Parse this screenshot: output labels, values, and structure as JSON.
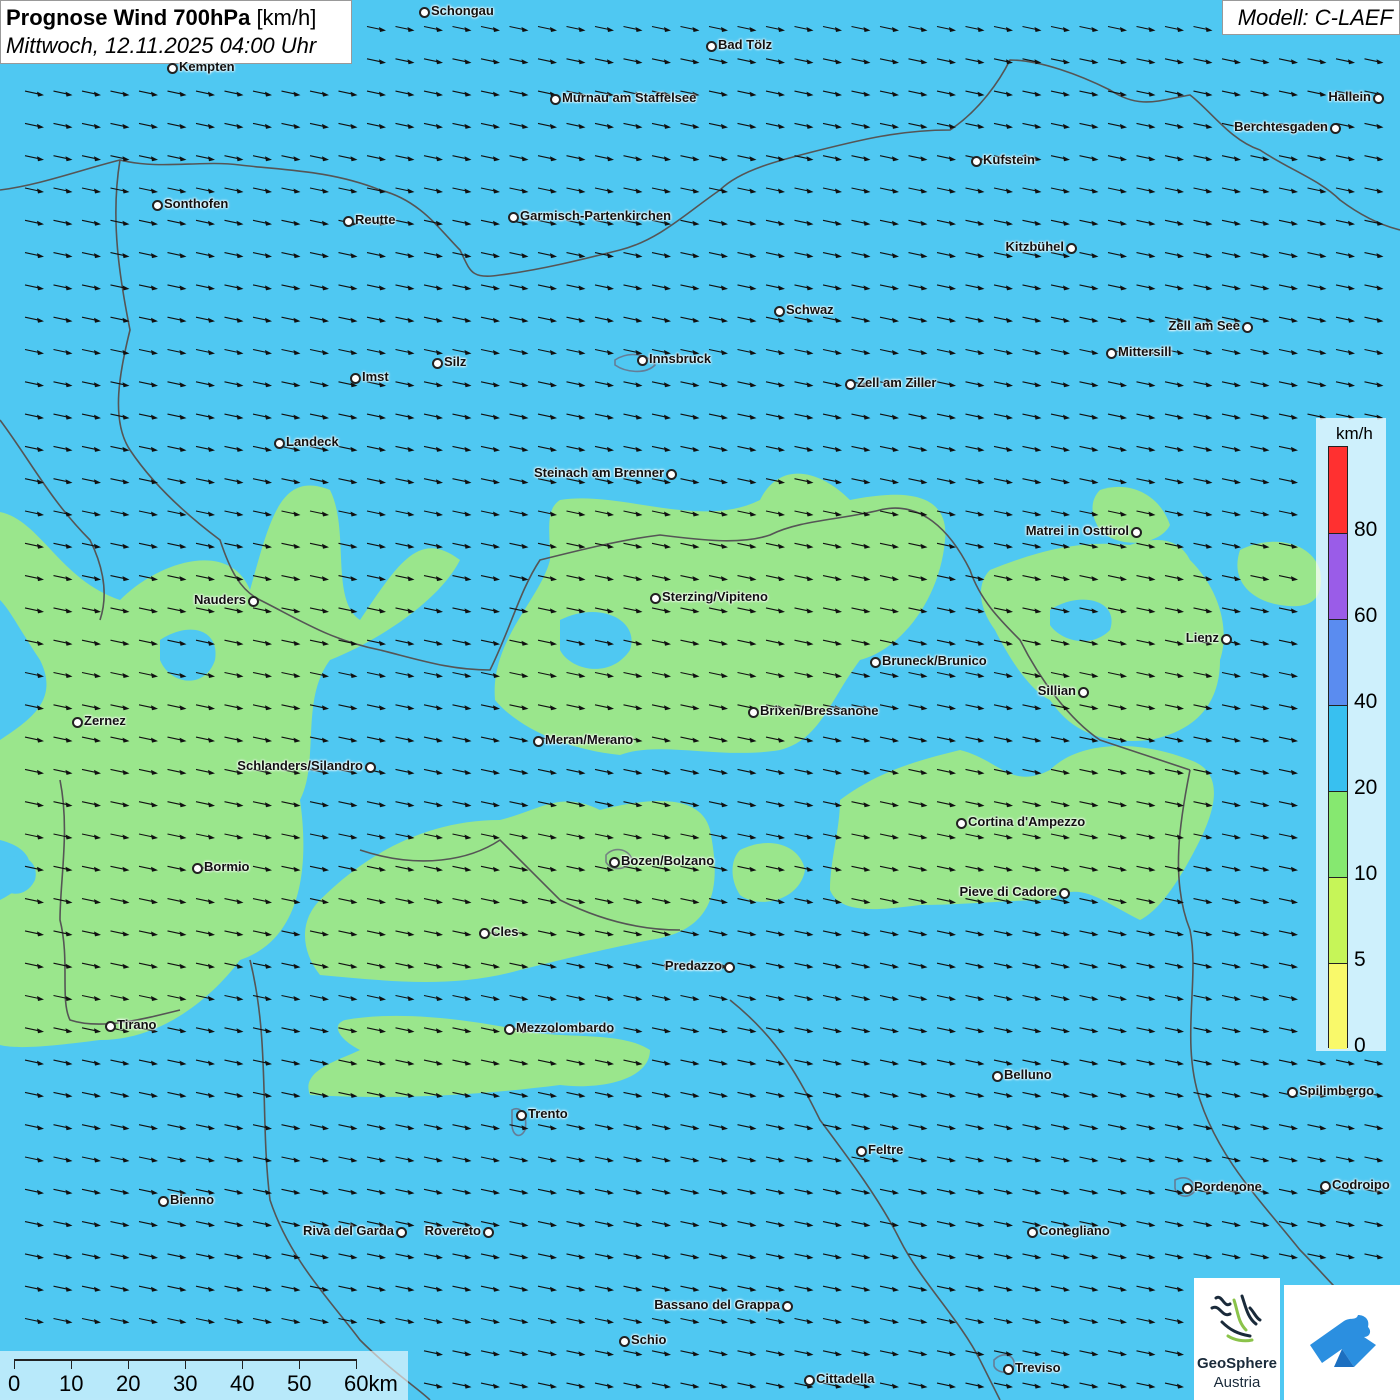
{
  "header": {
    "title_bold": "Prognose Wind 700hPa",
    "title_unit": "[km/h]",
    "datetime": "Mittwoch, 12.11.2025 04:00 Uhr"
  },
  "model": {
    "label": "Modell: C-LAEF"
  },
  "legend": {
    "unit": "km/h",
    "labels": [
      "80",
      "60",
      "40",
      "20",
      "10",
      "5",
      "0"
    ],
    "colors": [
      "#ff3030",
      "#9a5ce8",
      "#5a8cf0",
      "#38c0f0",
      "#86e870",
      "#c6f558",
      "#f9f96a"
    ]
  },
  "colors": {
    "background_wind": "#4fc8f2",
    "calm_wind": "#9ae68c",
    "border": "#555555",
    "arrow": "#111111"
  },
  "scalebar": {
    "labels": [
      "0",
      "10",
      "20",
      "30",
      "40",
      "50",
      "60km"
    ]
  },
  "logos": {
    "geosphere_line1": "GeoSphere",
    "geosphere_line2": "Austria",
    "geosphere_icon": "geosphere-logo-icon",
    "second_icon": "blue-shape-logo-icon"
  },
  "cities": [
    "Schongau",
    "Bad Tölz",
    "Kempten",
    "Murnau am Staffelsee",
    "Hallein",
    "Berchtesgaden",
    "Kufstein",
    "Sonthofen",
    "Reutte",
    "Garmisch-Partenkirchen",
    "Kitzbühel",
    "Schwaz",
    "Zell am See",
    "Innsbruck",
    "Mittersill",
    "Silz",
    "Imst",
    "Zell am Ziller",
    "Landeck",
    "Steinach am Brenner",
    "Matrei in Osttirol",
    "Nauders",
    "Sterzing/Vipiteno",
    "Lienz",
    "Bruneck/Brunico",
    "Sillian",
    "Zernez",
    "Brixen/Bressanone",
    "Meran/Merano",
    "Schlanders/Silandro",
    "Cortina d'Ampezzo",
    "Bozen/Bolzano",
    "Bormio",
    "Pieve di Cadore",
    "Cles",
    "Predazzo",
    "Tirano",
    "Mezzolombardo",
    "Belluno",
    "Spilimbergo",
    "Trento",
    "Feltre",
    "Pordenone",
    "Codroipo",
    "Bienno",
    "Riva del Garda",
    "Rovereto",
    "Conegliano",
    "Bassano del Grappa",
    "Schio",
    "Treviso",
    "Cittadella"
  ],
  "wind": {
    "direction": "west-northwest"
  }
}
